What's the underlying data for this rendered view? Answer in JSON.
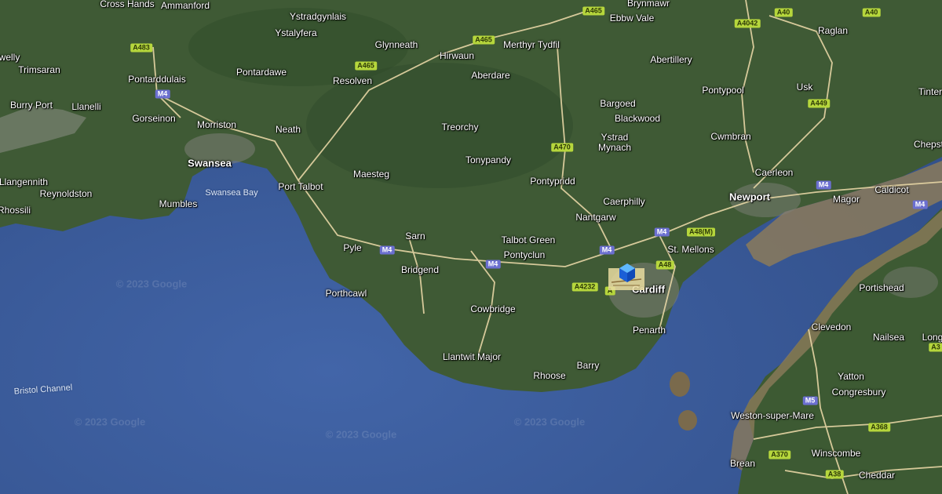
{
  "map": {
    "colors": {
      "sea": "#3a5c9a",
      "land": "#3f5a35",
      "estuary": "#8b7a5a",
      "roads": "#e7d6a5"
    },
    "water_labels": {
      "swansea_bay": "Swansea Bay",
      "bristol_channel": "Bristol Channel"
    },
    "places": {
      "cross_hands": "Cross Hands",
      "ammanford": "Ammanford",
      "welly": "welly",
      "trimsaran": "Trimsaran",
      "pontarddulais": "Pontarddulais",
      "burry_port": "Burry Port",
      "llanelli": "Llanelli",
      "gorseinon": "Gorseinon",
      "morriston": "Morriston",
      "swansea": "Swansea",
      "llangennith": "Llangennith",
      "reynoldston": "Reynoldston",
      "rhossili": "Rhossili",
      "mumbles": "Mumbles",
      "ystradgynlais": "Ystradgynlais",
      "ystalyfera": "Ystalyfera",
      "pontardawe": "Pontardawe",
      "resolven": "Resolven",
      "neath": "Neath",
      "port_talbot": "Port Talbot",
      "glynneath": "Glynneath",
      "hirwaun": "Hirwaun",
      "merthyr_tydfil": "Merthyr Tydfil",
      "aberdare": "Aberdare",
      "treorchy": "Treorchy",
      "tonypandy": "Tonypandy",
      "maesteg": "Maesteg",
      "pyle": "Pyle",
      "sarn": "Sarn",
      "bridgend": "Bridgend",
      "porthcawl": "Porthcawl",
      "talbot_green": "Talbot Green",
      "pontyclun": "Pontyclun",
      "cowbridge": "Cowbridge",
      "llantwit_major": "Llantwit Major",
      "rhoose": "Rhoose",
      "barry": "Barry",
      "pontypridd": "Pontypridd",
      "nantgarw": "Nantgarw",
      "caerphilly": "Caerphilly",
      "ystrad_mynach": "Ystrad\nMynach",
      "bargoed": "Bargoed",
      "blackwood": "Blackwood",
      "brynmawr": "Brynmawr",
      "ebbw_vale": "Ebbw Vale",
      "abertillery": "Abertillery",
      "pontypool": "Pontypool",
      "cwmbran": "Cwmbran",
      "raglan": "Raglan",
      "usk": "Usk",
      "caerleon": "Caerleon",
      "newport": "Newport",
      "magor": "Magor",
      "caldicot": "Caldicot",
      "tintern": "Tinter",
      "chepstow": "Chepst",
      "st_mellons": "St. Mellons",
      "cardiff": "Cardiff",
      "penarth": "Penarth",
      "portishead": "Portishead",
      "clevedon": "Clevedon",
      "nailsea": "Nailsea",
      "long": "Long",
      "yatton": "Yatton",
      "congresbury": "Congresbury",
      "weston_super_mare": "Weston-super-Mare",
      "winscombe": "Winscombe",
      "brean": "Brean",
      "cheddar": "Cheddar"
    },
    "roads": {
      "a483": "A483",
      "m4_swansea": "M4",
      "a465_west": "A465",
      "a465_mid": "A465",
      "a465_east": "A465",
      "a470": "A470",
      "m4_pyle": "M4",
      "m4_pontyclun": "M4",
      "a4232": "A4232",
      "m4_cardiff": "M4",
      "m4_stmellons": "M4",
      "a48m": "A48(M)",
      "a48": "A48",
      "a4042": "A4042",
      "a40_west": "A40",
      "a40_east": "A40",
      "a449": "A449",
      "m4_newport": "M4",
      "m4_severn": "M4",
      "m5": "M5",
      "a368": "A368",
      "a370": "A370",
      "a38": "A38",
      "a3_clipped": "A3",
      "a4232_clip": "A"
    },
    "watermark": "© 2023 Google",
    "marker": {
      "icon": "cube-icon",
      "place": "cardiff"
    }
  }
}
